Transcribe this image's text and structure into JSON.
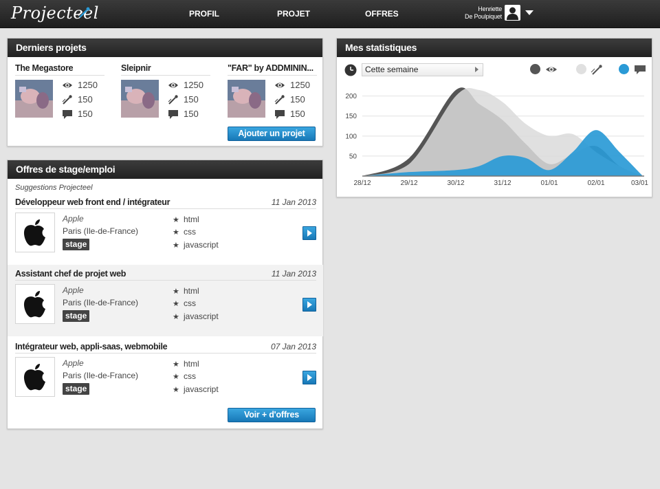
{
  "app": {
    "logo_text": "Projecteel",
    "nav": [
      "PROFIL",
      "PROJET",
      "OFFRES"
    ],
    "user": {
      "first": "Henriette",
      "last": "De Poulpiquet"
    }
  },
  "projects_panel": {
    "title": "Derniers projets",
    "items": [
      {
        "name": "The Megastore",
        "views": "1250",
        "likes": "150",
        "comments": "150"
      },
      {
        "name": "Sleipnir",
        "views": "1250",
        "likes": "150",
        "comments": "150"
      },
      {
        "name": "\"FAR\" by ADDMININ...",
        "views": "1250",
        "likes": "150",
        "comments": "150"
      }
    ],
    "add_button": "Ajouter un projet"
  },
  "offers_panel": {
    "title": "Offres de stage/emploi",
    "subtitle": "Suggestions Projecteel",
    "items": [
      {
        "title": "Développeur web front end / intégrateur",
        "date": "11 Jan 2013",
        "company": "Apple",
        "city": "Paris (Ile-de-France)",
        "type": "stage",
        "skills": [
          "html",
          "css",
          "javascript"
        ]
      },
      {
        "title": "Assistant chef de projet web",
        "date": "11 Jan 2013",
        "company": "Apple",
        "city": "Paris (Ile-de-France)",
        "type": "stage",
        "skills": [
          "html",
          "css",
          "javascript"
        ]
      },
      {
        "title": "Intégrateur web, appli-saas, webmobile",
        "date": "07 Jan 2013",
        "company": "Apple",
        "city": "Paris (Ile-de-France)",
        "type": "stage",
        "skills": [
          "html",
          "css",
          "javascript"
        ]
      }
    ],
    "more_button": "Voir + d'offres"
  },
  "stats_panel": {
    "title": "Mes statistiques",
    "period": "Cette semaine",
    "legend": [
      {
        "icon": "eye-icon",
        "color": "#555555"
      },
      {
        "icon": "pen-icon",
        "color": "#e0e0e0"
      },
      {
        "icon": "comment-icon",
        "color": "#2a9ad6"
      }
    ]
  },
  "chart_data": {
    "type": "area",
    "x": [
      "28/12",
      "29/12",
      "30/12",
      "31/12",
      "01/01",
      "02/01",
      "03/01"
    ],
    "yticks": [
      50,
      100,
      150,
      200
    ],
    "ylim": [
      0,
      220
    ],
    "grid": true,
    "series": [
      {
        "color": "#555555",
        "values": [
          0,
          45,
          215,
          180,
          140,
          80,
          30,
          55,
          75,
          25,
          0
        ]
      },
      {
        "color": "#dadada",
        "values": [
          0,
          30,
          200,
          215,
          185,
          130,
          100,
          105,
          60,
          25,
          0
        ]
      },
      {
        "color": "#2a9ad6",
        "values": [
          0,
          10,
          15,
          25,
          50,
          45,
          15,
          60,
          115,
          60,
          0
        ]
      }
    ],
    "x_positions": [
      0,
      1,
      2,
      2.5,
      3,
      3.5,
      4,
      4.5,
      5,
      5.5,
      6
    ]
  }
}
